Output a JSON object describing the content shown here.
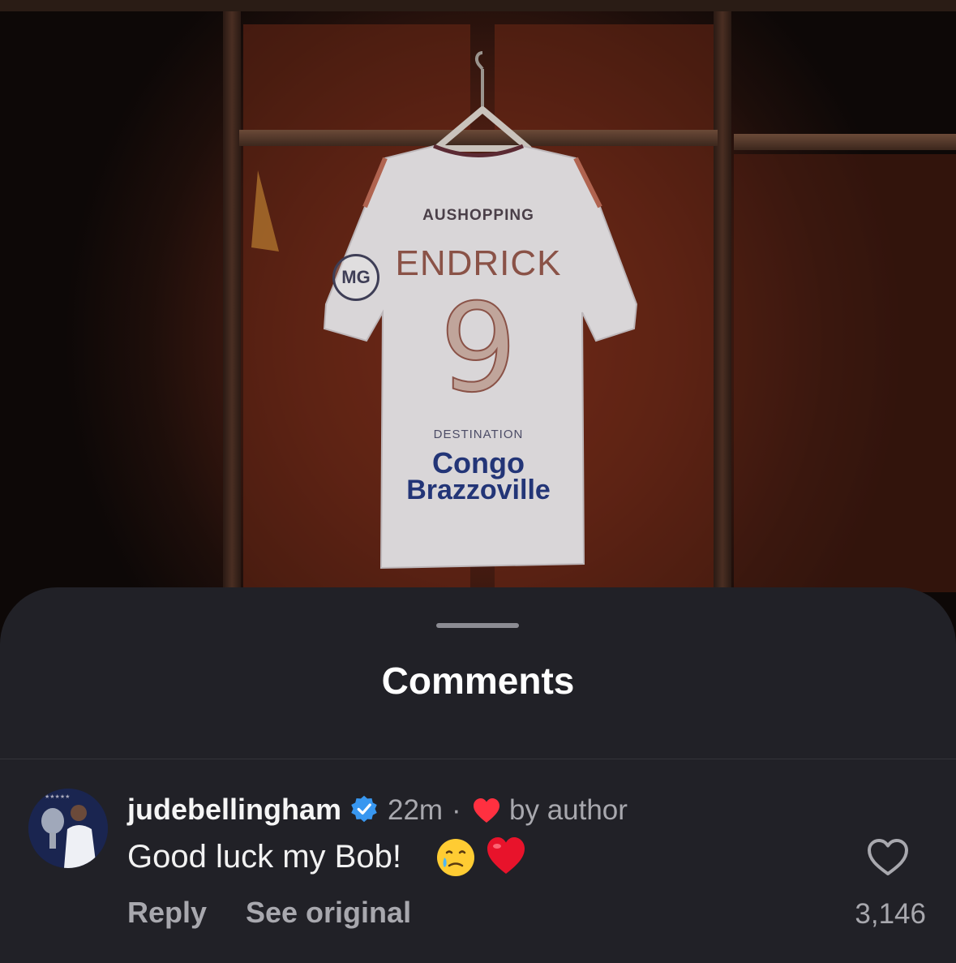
{
  "post": {
    "jersey": {
      "sponsor": "AUSHOPPING",
      "name": "ENDRICK",
      "number": "9",
      "destination_label": "DESTINATION",
      "destination_line1": "Congo",
      "destination_line2": "Brazzoville",
      "sleeve_badge": "MG"
    }
  },
  "comments_sheet": {
    "title": "Comments",
    "comments": [
      {
        "username": "judebellingham",
        "verified": true,
        "time": "22m",
        "separator": "·",
        "liked_by_author_label": "by author",
        "text": "Good luck my Bob!",
        "emojis": [
          "face-holding-back-tears",
          "red-heart"
        ],
        "reply_label": "Reply",
        "see_original_label": "See original",
        "like_count": "3,146"
      }
    ]
  },
  "colors": {
    "sheet_bg": "#212127",
    "verified_blue": "#3897f0",
    "heart_red": "#ff3040",
    "secondary_text": "#a8a8ae"
  }
}
